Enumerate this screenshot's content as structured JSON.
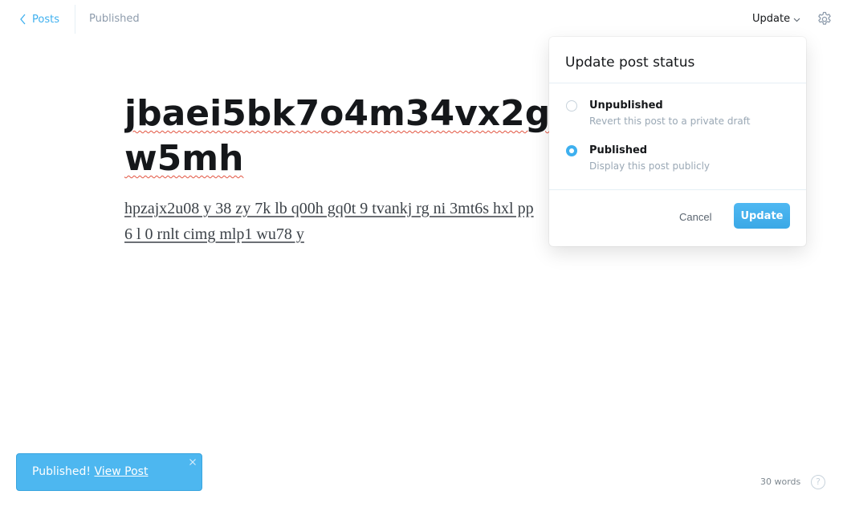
{
  "header": {
    "back_label": "Posts",
    "status": "Published",
    "update_trigger_label": "Update"
  },
  "editor": {
    "title_lines": [
      "jbaei5bk7o4m34vx2gy9",
      "w5mh"
    ],
    "body_lines": [
      "hpzajx2u08 y 38  zy  7k lb q00h gq0t 9  tvankj  rg ni 3mt6s hxl pp",
      "6 l 0 rnlt cimg  mlp1 wu78  y"
    ]
  },
  "publish_menu": {
    "title": "Update post status",
    "options": [
      {
        "label": "Unpublished",
        "description": "Revert this post to a private draft",
        "selected": false
      },
      {
        "label": "Published",
        "description": "Display this post publicly",
        "selected": true
      }
    ],
    "cancel_label": "Cancel",
    "update_label": "Update"
  },
  "notification": {
    "message": "Published!",
    "link_label": "View Post"
  },
  "footer": {
    "word_count": "30 words",
    "help_label": "?"
  },
  "colors": {
    "accent": "#3eb0ef",
    "notification_bg": "#4db7f0",
    "spellcheck": "#e25440"
  },
  "icons": {
    "back": "chevron-left-icon",
    "update_trigger": "chevron-down-icon",
    "settings": "gear-icon",
    "close": "close-icon",
    "help": "question-circle-icon"
  }
}
